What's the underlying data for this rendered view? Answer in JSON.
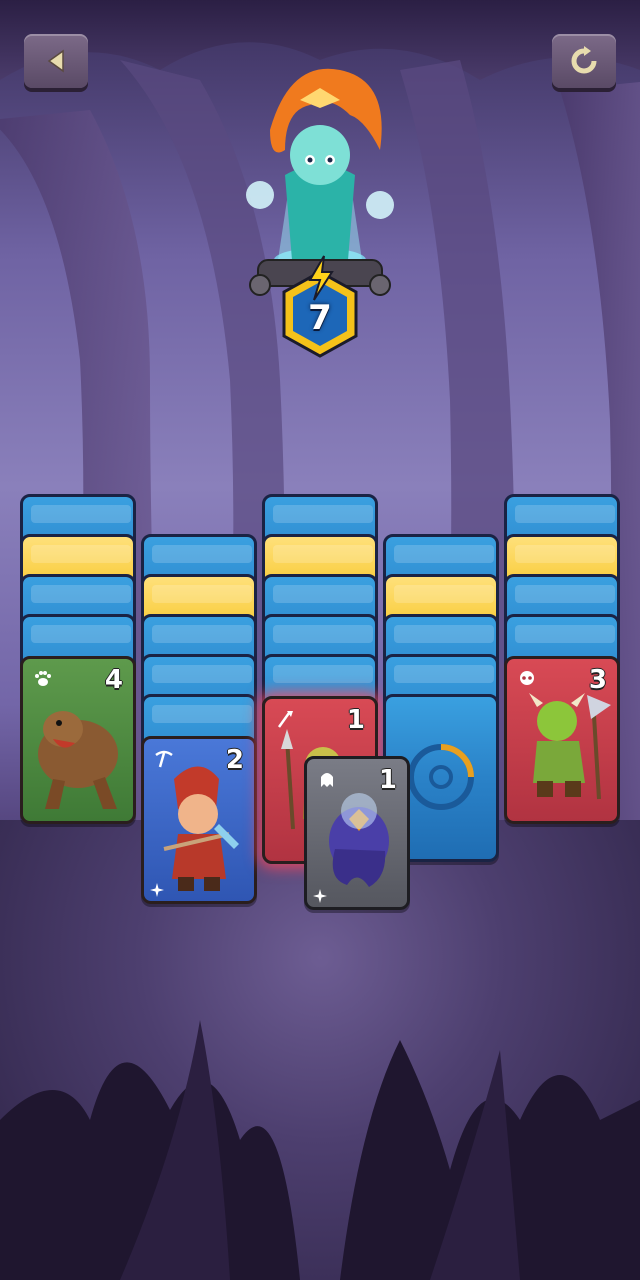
{
  "topbar": {
    "back_icon": "back-arrow-icon",
    "restart_icon": "restart-icon"
  },
  "boss": {
    "portrait": "sorceress-boss",
    "energy_icon": "lightning-icon",
    "energy": "7"
  },
  "cards": [
    {
      "column": 1,
      "kind": "back",
      "color": "blue"
    },
    {
      "column": 1,
      "kind": "back",
      "color": "gold"
    },
    {
      "column": 1,
      "kind": "back",
      "color": "blue"
    },
    {
      "column": 1,
      "kind": "back",
      "color": "blue"
    },
    {
      "column": 1,
      "kind": "face",
      "creature": "bear",
      "suit": "paw",
      "value": "4",
      "color": "#5e9a4c"
    },
    {
      "column": 2,
      "kind": "back",
      "color": "blue"
    },
    {
      "column": 2,
      "kind": "back",
      "color": "gold"
    },
    {
      "column": 2,
      "kind": "back",
      "color": "blue"
    },
    {
      "column": 2,
      "kind": "back",
      "color": "blue"
    },
    {
      "column": 2,
      "kind": "back",
      "color": "blue"
    },
    {
      "column": 2,
      "kind": "face",
      "creature": "dwarf-miner",
      "suit": "pickaxe",
      "value": "2",
      "color": "#4a78d8"
    },
    {
      "column": 3,
      "kind": "back",
      "color": "blue"
    },
    {
      "column": 3,
      "kind": "back",
      "color": "gold"
    },
    {
      "column": 3,
      "kind": "back",
      "color": "blue"
    },
    {
      "column": 3,
      "kind": "back",
      "color": "blue"
    },
    {
      "column": 3,
      "kind": "back",
      "color": "blue"
    },
    {
      "column": 3,
      "kind": "face",
      "creature": "goblin-spearman",
      "suit": "spear",
      "value": "1",
      "color": "#d84a55"
    },
    {
      "column": 4,
      "kind": "back",
      "color": "blue"
    },
    {
      "column": 4,
      "kind": "back",
      "color": "gold"
    },
    {
      "column": 4,
      "kind": "back",
      "color": "blue"
    },
    {
      "column": 4,
      "kind": "back",
      "color": "blue"
    },
    {
      "column": 4,
      "kind": "back",
      "color": "open-slot"
    },
    {
      "column": 5,
      "kind": "back",
      "color": "blue"
    },
    {
      "column": 5,
      "kind": "back",
      "color": "gold"
    },
    {
      "column": 5,
      "kind": "back",
      "color": "blue"
    },
    {
      "column": 5,
      "kind": "back",
      "color": "blue"
    },
    {
      "column": 5,
      "kind": "face",
      "creature": "orc-axeman",
      "suit": "skull",
      "value": "3",
      "color": "#d84a55"
    },
    {
      "column": "hand",
      "kind": "face",
      "creature": "ghost-flame",
      "suit": "ghost",
      "value": "1",
      "color": "#7a7c86"
    }
  ]
}
